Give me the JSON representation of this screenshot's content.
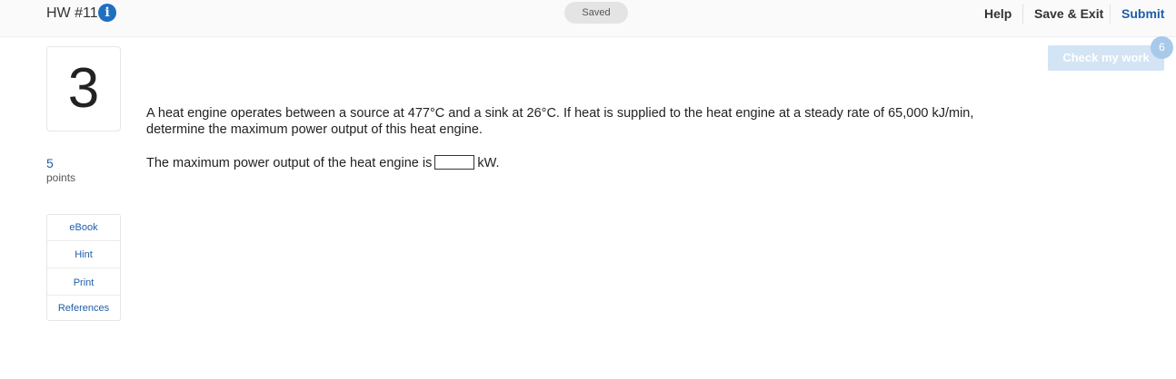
{
  "header": {
    "title": "HW #11",
    "info_icon": "info-icon",
    "status": "Saved",
    "help_label": "Help",
    "save_exit_label": "Save & Exit",
    "submit_label": "Submit"
  },
  "question": {
    "number": "3",
    "points_value": "5",
    "points_label": "points",
    "text": "A heat engine operates between a source at 477°C and a sink at 26°C. If heat is supplied to the heat engine at a steady rate of 65,000 kJ/min, determine the maximum power output of this heat engine.",
    "answer_prefix": "The maximum power output of the heat engine is",
    "answer_value": "",
    "answer_unit": "kW."
  },
  "tools": {
    "items": [
      {
        "label": "eBook"
      },
      {
        "label": "Hint"
      },
      {
        "label": "Print"
      },
      {
        "label": "References"
      }
    ]
  },
  "check_work": {
    "label": "Check my work",
    "remaining": "6"
  },
  "colors": {
    "accent": "#1f5fa8",
    "check_button_disabled": "#d3e4f4",
    "badge": "#a9c9ea",
    "info_icon": "#1f6fc1"
  }
}
